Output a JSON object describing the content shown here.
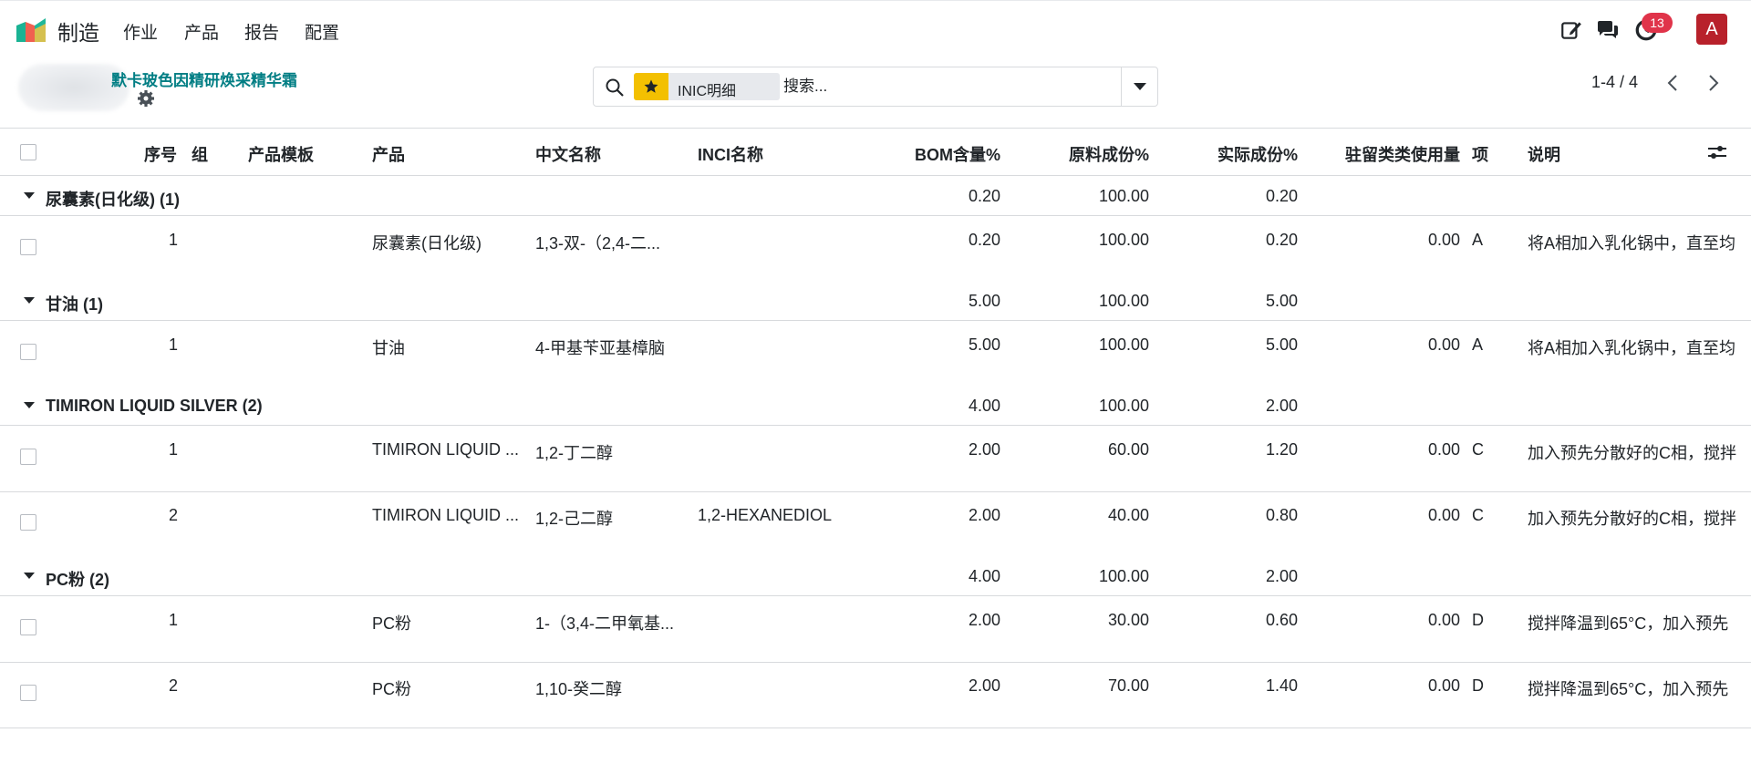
{
  "nav": {
    "app_name": "制造",
    "menus": [
      "作业",
      "产品",
      "报告",
      "配置"
    ],
    "activity_count": "13",
    "avatar_letter": "A"
  },
  "control": {
    "record_title": "默卡玻色因精研焕采精华霜",
    "search": {
      "facet_label": "INIC明细",
      "placeholder": "搜索..."
    },
    "pager": "1-4 / 4"
  },
  "table": {
    "headers": {
      "seq": "序号",
      "group": "组",
      "template": "产品模板",
      "product": "产品",
      "cn_name": "中文名称",
      "inci": "INCI名称",
      "bom": "BOM含量%",
      "raw": "原料成份%",
      "actual": "实际成份%",
      "usage": "驻留类类使用量",
      "item": "项",
      "note": "说明"
    },
    "groups": [
      {
        "label": "尿囊素(日化级) (1)",
        "bom": "0.20",
        "raw": "100.00",
        "actual": "0.20",
        "rows": [
          {
            "seq": "1",
            "product": "尿囊素(日化级)",
            "cn_name": "1,3-双-（2,4-二...",
            "inci": "",
            "bom": "0.20",
            "raw": "100.00",
            "actual": "0.20",
            "usage": "0.00",
            "item": "A",
            "note": "将A相加入乳化锅中，直至均"
          }
        ]
      },
      {
        "label": "甘油 (1)",
        "bom": "5.00",
        "raw": "100.00",
        "actual": "5.00",
        "rows": [
          {
            "seq": "1",
            "product": "甘油",
            "cn_name": "4-甲基苄亚基樟脑",
            "inci": "",
            "bom": "5.00",
            "raw": "100.00",
            "actual": "5.00",
            "usage": "0.00",
            "item": "A",
            "note": "将A相加入乳化锅中，直至均"
          }
        ]
      },
      {
        "label": "TIMIRON LIQUID SILVER (2)",
        "bom": "4.00",
        "raw": "100.00",
        "actual": "2.00",
        "rows": [
          {
            "seq": "1",
            "product": "TIMIRON LIQUID ...",
            "cn_name": "1,2-丁二醇",
            "inci": "",
            "bom": "2.00",
            "raw": "60.00",
            "actual": "1.20",
            "usage": "0.00",
            "item": "C",
            "note": "加入预先分散好的C相，搅拌"
          },
          {
            "seq": "2",
            "product": "TIMIRON LIQUID ...",
            "cn_name": "1,2-己二醇",
            "inci": "1,2-HEXANEDIOL",
            "bom": "2.00",
            "raw": "40.00",
            "actual": "0.80",
            "usage": "0.00",
            "item": "C",
            "note": "加入预先分散好的C相，搅拌"
          }
        ]
      },
      {
        "label": "PC粉 (2)",
        "bom": "4.00",
        "raw": "100.00",
        "actual": "2.00",
        "rows": [
          {
            "seq": "1",
            "product": "PC粉",
            "cn_name": "1-（3,4-二甲氧基...",
            "inci": "",
            "bom": "2.00",
            "raw": "30.00",
            "actual": "0.60",
            "usage": "0.00",
            "item": "D",
            "note": "搅拌降温到65°C，加入预先"
          },
          {
            "seq": "2",
            "product": "PC粉",
            "cn_name": "1,10-癸二醇",
            "inci": "",
            "bom": "2.00",
            "raw": "70.00",
            "actual": "1.40",
            "usage": "0.00",
            "item": "D",
            "note": "搅拌降温到65°C，加入预先"
          }
        ]
      }
    ]
  },
  "colors": {
    "brand_teal": "#017e84",
    "facet_star": "#f3c001",
    "badge": "#e0344a",
    "avatar": "#b8212b"
  }
}
